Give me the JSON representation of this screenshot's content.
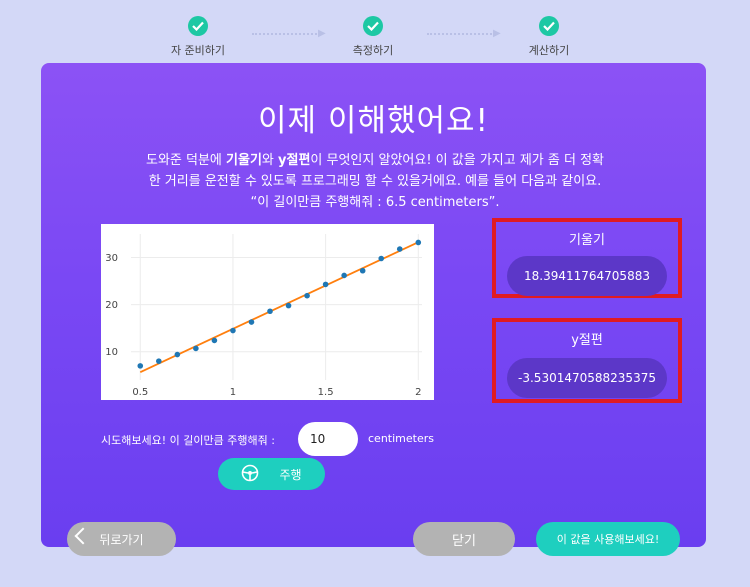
{
  "stepper": {
    "steps": [
      {
        "label": "자 준비하기"
      },
      {
        "label": "측정하기"
      },
      {
        "label": "계산하기"
      }
    ]
  },
  "main": {
    "title": "이제 이해했어요!",
    "description": {
      "p1": "도와준 덕분에 ",
      "b1": "기울기",
      "p2": "와 ",
      "b2": "y절편",
      "p3": "이 무엇인지 알았어요! 이 값을 가지고 제가 좀 더 정확",
      "line2": "한 거리를 운전할 수 있도록 프로그래밍 할 수 있을거에요. 예를 들어 다음과 같이요.",
      "line3": "“이 길이만큼 주행해줘 : 6.5 centimeters”."
    }
  },
  "results": {
    "slope": {
      "title": "기울기",
      "value": "18.39411764705883"
    },
    "intercept": {
      "title": "y절편",
      "value": "-3.5301470588235375"
    }
  },
  "try_area": {
    "label": "시도해보세요! 이 길이만큼 주행해줘 :",
    "input_value": "10",
    "unit": "centimeters",
    "run_label": "주행"
  },
  "buttons": {
    "back": "뒤로가기",
    "close": "닫기",
    "use": "이 값을 사용해보세요!"
  },
  "colors": {
    "accent": "#1ecfbf",
    "panel": "#7a48f4",
    "highlight_border": "#e01b22",
    "points": "#1f77b4",
    "fit_line": "#ff7f0e"
  },
  "chart_data": {
    "type": "scatter",
    "x": [
      0.5,
      0.6,
      0.7,
      0.8,
      0.9,
      1.0,
      1.1,
      1.2,
      1.3,
      1.4,
      1.5,
      1.6,
      1.7,
      1.8,
      1.9,
      2.0
    ],
    "y": [
      7,
      8,
      9.4,
      10.7,
      12.4,
      14.5,
      16.3,
      18.6,
      19.8,
      21.9,
      24.3,
      26.2,
      27.2,
      29.8,
      31.8,
      33.2
    ],
    "fit_line": {
      "slope": 18.39411764705883,
      "intercept": -3.5301470588235375
    },
    "xlim": [
      0.45,
      2.02
    ],
    "ylim": [
      4,
      35
    ],
    "x_ticks": [
      0.5,
      1,
      1.5,
      2
    ],
    "x_tick_labels": [
      "0.5",
      "1",
      "1.5",
      "2"
    ],
    "y_ticks": [
      10,
      20,
      30
    ],
    "y_tick_labels": [
      "10",
      "20",
      "30"
    ],
    "grid": true
  }
}
